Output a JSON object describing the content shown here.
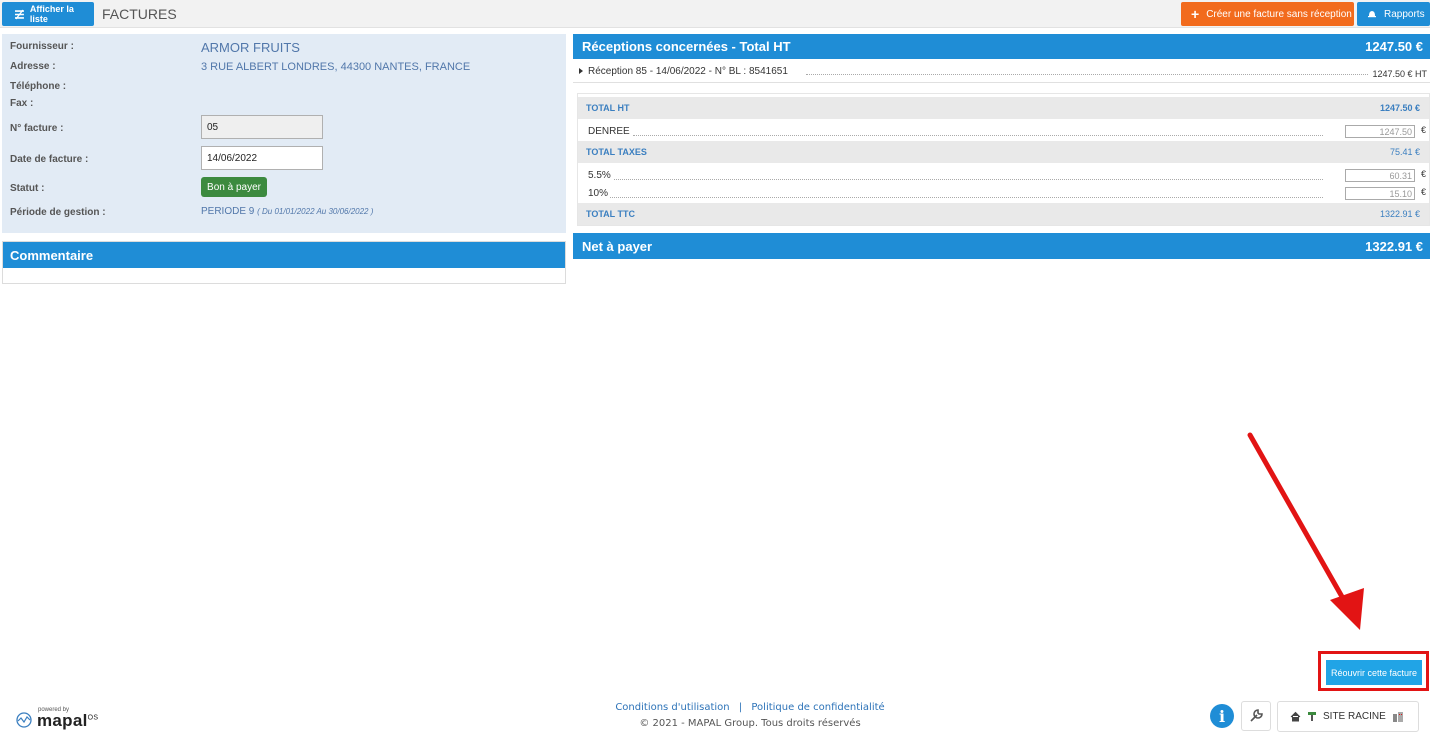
{
  "topbar": {
    "list_button": "Afficher la liste",
    "title": "FACTURES",
    "create_button": "Créer une facture sans réception",
    "reports_button": "Rapports"
  },
  "supplier": {
    "supplier_label": "Fournisseur :",
    "supplier_value": "ARMOR FRUITS",
    "address_label": "Adresse :",
    "address_value": "3 RUE ALBERT LONDRES, 44300 NANTES, FRANCE",
    "phone_label": "Téléphone :",
    "fax_label": "Fax :",
    "invoice_no_label": "N° facture :",
    "invoice_no_value": "05",
    "invoice_date_label": "Date de facture :",
    "invoice_date_value": "14/06/2022",
    "status_label": "Statut :",
    "status_value": "Bon à payer",
    "period_label": "Période de gestion :",
    "period_value": "PERIODE 9",
    "period_range": "( Du 01/01/2022 Au 30/06/2022 )"
  },
  "comment": {
    "title": "Commentaire"
  },
  "receptions": {
    "title": "Réceptions concernées - Total HT",
    "total": "1247.50 €",
    "items": [
      {
        "text": "Réception 85  -  14/06/2022  -  N° BL : 8541651",
        "amount": "1247.50 € HT"
      }
    ]
  },
  "totals": {
    "total_ht_label": "TOTAL HT",
    "total_ht_value": "1247.50 €",
    "lines_ht": [
      {
        "label": "DENREE",
        "value": "1247.50",
        "currency": "€"
      }
    ],
    "total_taxes_label": "TOTAL TAXES",
    "total_taxes_value": "75.41 €",
    "lines_tax": [
      {
        "label": "5.5%",
        "value": "60.31",
        "currency": "€"
      },
      {
        "label": "10%",
        "value": "15.10",
        "currency": "€"
      }
    ],
    "total_ttc_label": "TOTAL TTC",
    "total_ttc_value": "1322.91 €",
    "net_label": "Net à payer",
    "net_value": "1322.91 €"
  },
  "actions": {
    "reopen_button": "Réouvrir cette facture"
  },
  "footer": {
    "powered_by": "powered by",
    "logo_text": "mapal",
    "logo_sup": "OS",
    "terms_link": "Conditions d'utilisation",
    "separator": "|",
    "privacy_link": "Politique de confidentialité",
    "copyright": "© 2021 - MAPAL Group. Tous droits réservés",
    "info_glyph": "i",
    "site_button": "SITE RACINE"
  },
  "colors": {
    "primary_blue": "#1f8dd6",
    "orange": "#f26b1d",
    "status_green": "#3c8a3f",
    "annotation_red": "#e21414"
  }
}
